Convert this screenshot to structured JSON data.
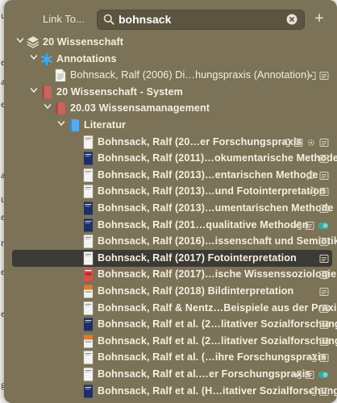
{
  "header": {
    "link_to_label": "Link To...",
    "search_value": "bohnsack",
    "add_label": "+"
  },
  "background_letters": [
    "u",
    "e",
    "a",
    "e",
    "a",
    "u",
    "e",
    "r",
    "e",
    "e",
    "g"
  ],
  "tree": [
    {
      "label": "20 Wissenschaft",
      "depth": 0,
      "icon": "stack-icon",
      "disclosure": "expanded",
      "bold": true,
      "trailing": []
    },
    {
      "label": "Annotations",
      "depth": 1,
      "icon": "asterisk-icon",
      "disclosure": "expanded",
      "bold": true,
      "trailing": []
    },
    {
      "label": "Bohnsack, Ralf (2006) Di…hungspraxis (Annotation)",
      "depth": 2,
      "icon": "text-document-icon",
      "disclosure": "none",
      "bold": false,
      "trailing": [
        "link-icon",
        "card-icon"
      ]
    },
    {
      "label": "20 Wissenschaft - System",
      "depth": 1,
      "icon": "red-book-icon",
      "disclosure": "expanded",
      "bold": true,
      "trailing": []
    },
    {
      "label": "20.03 Wissensamanagement",
      "depth": 2,
      "icon": "red-book-icon",
      "disclosure": "expanded",
      "bold": true,
      "trailing": []
    },
    {
      "label": "Literatur",
      "depth": 3,
      "icon": "blue-book-icon",
      "disclosure": "expanded",
      "bold": true,
      "trailing": []
    },
    {
      "label": "Bohnsack, Ralf (20…er Forschungspraxis",
      "depth": 4,
      "icon": "book-cover-white-icon",
      "disclosure": "none",
      "bold": true,
      "trailing": [
        "link-icon",
        "card-icon",
        "gear-icon",
        "card-icon"
      ]
    },
    {
      "label": "Bohnsack, Ralf (2011)…okumentarische Methode",
      "depth": 4,
      "icon": "book-cover-navy-icon",
      "disclosure": "none",
      "bold": true,
      "trailing": [
        "card-icon"
      ]
    },
    {
      "label": "Bohnsack, Ralf (2013)…entarischen Methode",
      "depth": 4,
      "icon": "book-cover-white-icon",
      "disclosure": "none",
      "bold": true,
      "trailing": [
        "comment-icon",
        "card-icon"
      ]
    },
    {
      "label": "Bohnsack, Ralf (2013)…und Fotointerpretation",
      "depth": 4,
      "icon": "book-cover-white-icon",
      "disclosure": "none",
      "bold": true,
      "trailing": [
        "link-icon",
        "card-icon"
      ]
    },
    {
      "label": "Bohnsack, Ralf (2013)…umentarischen Methode",
      "depth": 4,
      "icon": "book-cover-navy-icon",
      "disclosure": "none",
      "bold": true,
      "trailing": [
        "card-icon"
      ]
    },
    {
      "label": "Bohnsack, Ralf (201…qualitative Methoden",
      "depth": 4,
      "icon": "book-cover-navy-icon",
      "disclosure": "none",
      "bold": true,
      "trailing": [
        "link-icon",
        "card-icon",
        "toggle-icon"
      ]
    },
    {
      "label": "Bohnsack, Ralf (2016)…issenschaft und Semiotik",
      "depth": 4,
      "icon": "book-cover-white-icon",
      "disclosure": "none",
      "bold": true,
      "trailing": [
        "card-icon"
      ]
    },
    {
      "label": "Bohnsack, Ralf (2017) Fotointerpretation",
      "depth": 4,
      "icon": "book-cover-white-icon",
      "disclosure": "none",
      "bold": true,
      "selected": true,
      "trailing": [
        "card-icon"
      ]
    },
    {
      "label": "Bohnsack, Ralf (2017)…ische Wissenssoziologie",
      "depth": 4,
      "icon": "book-cover-red-icon",
      "disclosure": "none",
      "bold": true,
      "trailing": [
        "card-icon"
      ]
    },
    {
      "label": "Bohnsack, Ralf (2018) Bildinterpretation",
      "depth": 4,
      "icon": "book-cover-orange-icon",
      "disclosure": "none",
      "bold": true,
      "trailing": [
        "card-icon"
      ]
    },
    {
      "label": "Bohnsack, Ralf & Nentz…Beispiele aus der Praxis",
      "depth": 4,
      "icon": "book-cover-white-icon",
      "disclosure": "none",
      "bold": true,
      "trailing": [
        "card-icon"
      ]
    },
    {
      "label": "Bohnsack, Ralf et al. (2…litativer Sozialforschung",
      "depth": 4,
      "icon": "book-cover-navy-icon",
      "disclosure": "none",
      "bold": true,
      "trailing": [
        "card-icon"
      ]
    },
    {
      "label": "Bohnsack, Ralf et al. (2…litativer Sozialforschung",
      "depth": 4,
      "icon": "book-cover-orange-icon",
      "disclosure": "none",
      "bold": true,
      "trailing": [
        "card-icon"
      ]
    },
    {
      "label": "Bohnsack, Ralf et al. (…ihre Forschungspraxis",
      "depth": 4,
      "icon": "book-cover-white-icon",
      "disclosure": "none",
      "bold": true,
      "trailing": [
        "link-icon",
        "card-icon"
      ]
    },
    {
      "label": "Bohnsack, Ralf et al.…er Forschungspraxis",
      "depth": 4,
      "icon": "book-cover-white-icon",
      "disclosure": "none",
      "bold": true,
      "trailing": [
        "link-icon",
        "card-icon",
        "toggle-icon"
      ]
    },
    {
      "label": "Bohnsack, Ralf et al. (H…itativer Sozialforschung",
      "depth": 4,
      "icon": "book-cover-navy-icon",
      "disclosure": "none",
      "bold": true,
      "trailing": [
        "link-icon",
        "card-icon"
      ]
    }
  ],
  "colors": {
    "panel_bg": "#7b7257",
    "selection_bg": "#3c3a35",
    "text": "#f5efe0",
    "accent_blue": "#3fa9f5",
    "toggle_teal": "#3aa89a"
  }
}
